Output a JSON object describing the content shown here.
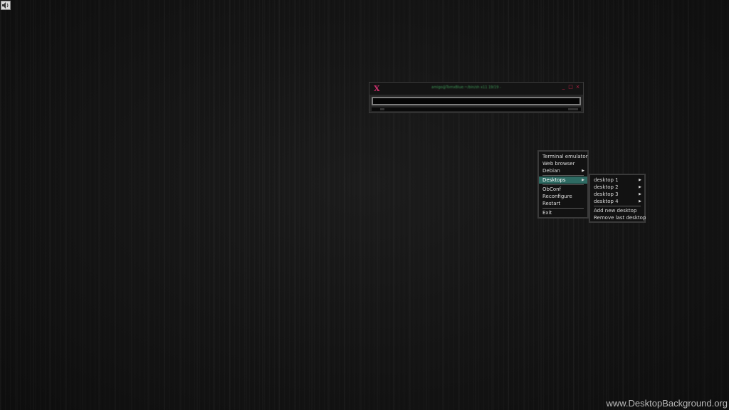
{
  "tray": {
    "volume_icon": "speaker-icon"
  },
  "terminal": {
    "app_icon": "X",
    "title": "amigo@TomxBlue:~/bin/sh x11 19/19 -",
    "buttons": [
      "_",
      "□",
      "×"
    ]
  },
  "root_menu": {
    "items": [
      {
        "label": "Terminal emulator"
      },
      {
        "label": "Web browser"
      },
      {
        "label": "Debian",
        "submenu": true
      }
    ],
    "desktops_label": "Desktops",
    "obconf_label": "ObConf",
    "reconfigure_label": "Reconfigure",
    "restart_label": "Restart",
    "exit_label": "Exit"
  },
  "desktops_menu": {
    "items": [
      "desktop 1",
      "desktop 2",
      "desktop 3",
      "desktop 4"
    ],
    "add_label": "Add new desktop",
    "remove_label": "Remove last desktop"
  },
  "watermark": "www.DesktopBackground.org",
  "colors": {
    "menu_highlight": "#2e6b63",
    "close_accent": "#c1264a",
    "title_text": "#3e9a57"
  }
}
